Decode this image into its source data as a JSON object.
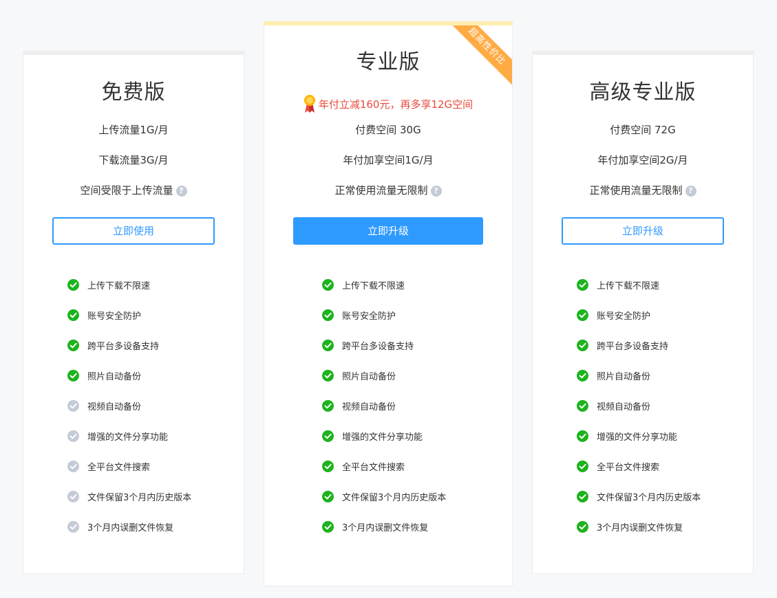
{
  "colors": {
    "accent": "#2e9aff",
    "check_enabled": "#1db31d",
    "check_disabled": "#c4cbd6",
    "promo_text": "#e84a3c",
    "ribbon": "#ffab44"
  },
  "plans": [
    {
      "title": "免费版",
      "details": [
        "上传流量1G/月",
        "下载流量3G/月",
        "空间受限于上传流量"
      ],
      "button": "立即使用",
      "features": [
        {
          "label": "上传下载不限速",
          "enabled": true
        },
        {
          "label": "账号安全防护",
          "enabled": true
        },
        {
          "label": "跨平台多设备支持",
          "enabled": true
        },
        {
          "label": "照片自动备份",
          "enabled": true
        },
        {
          "label": "视频自动备份",
          "enabled": false
        },
        {
          "label": "增强的文件分享功能",
          "enabled": false
        },
        {
          "label": "全平台文件搜索",
          "enabled": false
        },
        {
          "label": "文件保留3个月内历史版本",
          "enabled": false
        },
        {
          "label": "3个月内误删文件恢复",
          "enabled": false
        }
      ]
    },
    {
      "title": "专业版",
      "ribbon": "超高性价比",
      "promo": "年付立减160元，再多享12G空间",
      "details": [
        "付费空间 30G",
        "年付加享空间1G/月",
        "正常使用流量无限制"
      ],
      "button": "立即升级",
      "features": [
        {
          "label": "上传下载不限速",
          "enabled": true
        },
        {
          "label": "账号安全防护",
          "enabled": true
        },
        {
          "label": "跨平台多设备支持",
          "enabled": true
        },
        {
          "label": "照片自动备份",
          "enabled": true
        },
        {
          "label": "视频自动备份",
          "enabled": true
        },
        {
          "label": "增强的文件分享功能",
          "enabled": true
        },
        {
          "label": "全平台文件搜索",
          "enabled": true
        },
        {
          "label": "文件保留3个月内历史版本",
          "enabled": true
        },
        {
          "label": "3个月内误删文件恢复",
          "enabled": true
        }
      ]
    },
    {
      "title": "高级专业版",
      "details": [
        "付费空间 72G",
        "年付加享空间2G/月",
        "正常使用流量无限制"
      ],
      "button": "立即升级",
      "features": [
        {
          "label": "上传下载不限速",
          "enabled": true
        },
        {
          "label": "账号安全防护",
          "enabled": true
        },
        {
          "label": "跨平台多设备支持",
          "enabled": true
        },
        {
          "label": "照片自动备份",
          "enabled": true
        },
        {
          "label": "视频自动备份",
          "enabled": true
        },
        {
          "label": "增强的文件分享功能",
          "enabled": true
        },
        {
          "label": "全平台文件搜索",
          "enabled": true
        },
        {
          "label": "文件保留3个月内历史版本",
          "enabled": true
        },
        {
          "label": "3个月内误删文件恢复",
          "enabled": true
        }
      ]
    }
  ],
  "help_icon_glyph": "?"
}
